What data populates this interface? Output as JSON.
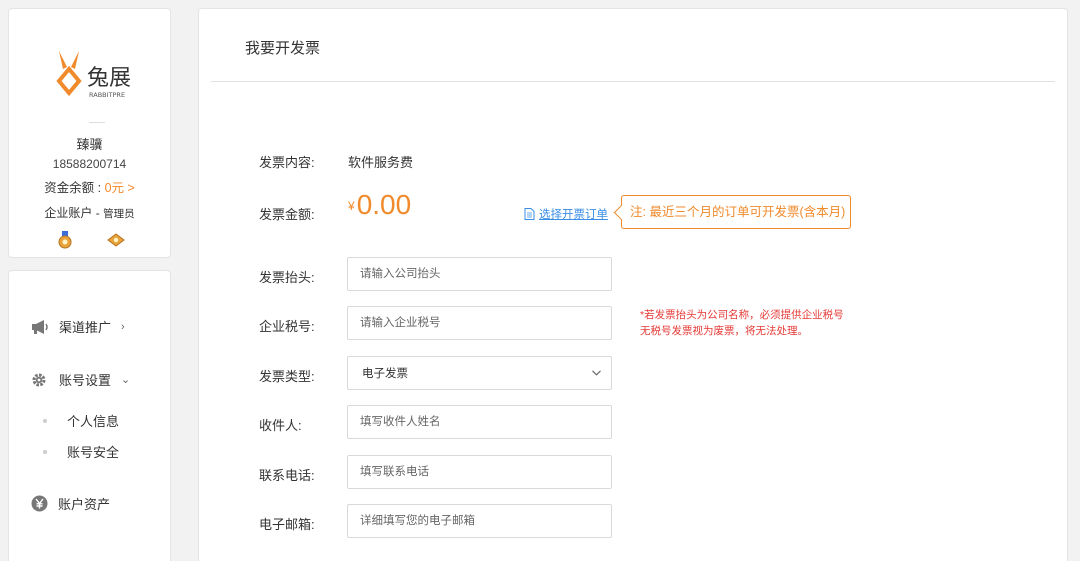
{
  "profile": {
    "logo_text": "兔展",
    "logo_sub": "RABBITPRE",
    "name": "臻骥",
    "phone": "18588200714",
    "balance_label": "资金余额 : ",
    "balance_value": "0元 >",
    "account_type": "企业账户 - ",
    "account_role": "管理员"
  },
  "nav": {
    "items": [
      {
        "label": "渠道推广",
        "icon": "megaphone-icon",
        "chevron": "›"
      },
      {
        "label": "账号设置",
        "icon": "gear-icon",
        "chevron": "⌄"
      },
      {
        "label": "账户资产",
        "icon": "yen-circle-icon"
      }
    ],
    "sub_items": [
      {
        "label": "个人信息"
      },
      {
        "label": "账号安全"
      }
    ]
  },
  "main": {
    "title": "我要开发票",
    "content_label": "发票内容:",
    "content_value": "软件服务费",
    "amount_label": "发票金额:",
    "amount_currency": "¥",
    "amount_value": "0.00",
    "select_orders": "选择开票订单",
    "note": "注: 最近三个月的订单可开发票(含本月)",
    "fields": [
      {
        "label": "发票抬头:",
        "placeholder": "请输入公司抬头"
      },
      {
        "label": "企业税号:",
        "placeholder": "请输入企业税号"
      },
      {
        "label": "发票类型:",
        "value": "电子发票"
      },
      {
        "label": "收件人:",
        "placeholder": "填写收件人姓名"
      },
      {
        "label": "联系电话:",
        "placeholder": "填写联系电话"
      },
      {
        "label": "电子邮箱:",
        "placeholder": "详细填写您的电子邮箱"
      }
    ],
    "warning_line1": "*若发票抬头为公司名称，必须提供企业税号",
    "warning_line2": "无税号发票视为废票，将无法处理。"
  },
  "colors": {
    "accent": "#f08a2b",
    "link": "#3a8ee6",
    "warning": "#e53935"
  }
}
